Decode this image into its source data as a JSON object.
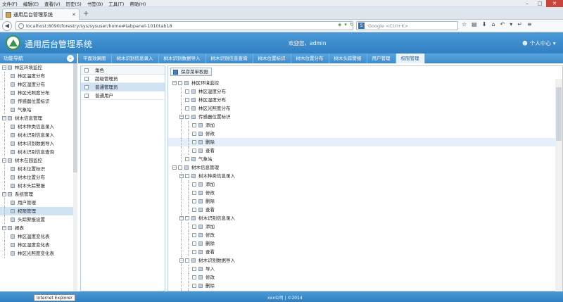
{
  "browser": {
    "menu": [
      "文件(F)",
      "编辑(E)",
      "查看(V)",
      "历史(S)",
      "书签(B)",
      "工具(T)",
      "帮助(H)"
    ],
    "tab_title": "通用后台管理系统",
    "url": "localhost:8090/forestry/sys/sysuser/home#tabpanel-1010tab18",
    "search_placeholder": "Google <Ctrl+K>"
  },
  "header": {
    "title": "通用后台管理系统",
    "welcome": "欢迎您，admin",
    "user_center": "个人中心"
  },
  "sidebar": {
    "title": "功能导航",
    "tree": [
      {
        "label": "林区环境监控",
        "level": 0,
        "type": "folder"
      },
      {
        "label": "林区温度分布",
        "level": 1,
        "type": "leaf"
      },
      {
        "label": "林区湿度分布",
        "level": 1,
        "type": "leaf"
      },
      {
        "label": "林区光照度分布",
        "level": 1,
        "type": "leaf"
      },
      {
        "label": "传感器位置标识",
        "level": 1,
        "type": "leaf"
      },
      {
        "label": "气象站",
        "level": 1,
        "type": "leaf"
      },
      {
        "label": "树木信息管理",
        "level": 0,
        "type": "folder"
      },
      {
        "label": "树木种类信息录入",
        "level": 1,
        "type": "leaf"
      },
      {
        "label": "树木识别信息录入",
        "level": 1,
        "type": "leaf"
      },
      {
        "label": "树木识别数据导入",
        "level": 1,
        "type": "leaf"
      },
      {
        "label": "树木识别信息查询",
        "level": 1,
        "type": "leaf"
      },
      {
        "label": "树木在园监控",
        "level": 0,
        "type": "folder"
      },
      {
        "label": "树木位置标识",
        "level": 1,
        "type": "leaf"
      },
      {
        "label": "树木位置分布",
        "level": 1,
        "type": "leaf"
      },
      {
        "label": "树木头踪警报",
        "level": 1,
        "type": "leaf"
      },
      {
        "label": "系统管理",
        "level": 0,
        "type": "folder"
      },
      {
        "label": "用户管理",
        "level": 1,
        "type": "leaf"
      },
      {
        "label": "权限管理",
        "level": 1,
        "type": "leaf",
        "selected": true
      },
      {
        "label": "头踪警报设置",
        "level": 1,
        "type": "leaf"
      },
      {
        "label": "报表",
        "level": 0,
        "type": "folder"
      },
      {
        "label": "林区温度变化表",
        "level": 1,
        "type": "leaf"
      },
      {
        "label": "林区湿度变化表",
        "level": 1,
        "type": "leaf"
      },
      {
        "label": "林区光照度变化表",
        "level": 1,
        "type": "leaf"
      }
    ]
  },
  "tabs": [
    "平面效果图",
    "树木识别信息录入",
    "树木识别数据导入",
    "树木识别信息查询",
    "树木位置标识",
    "树木位置分布",
    "树木头踪警报",
    "用户管理",
    "权限管理"
  ],
  "active_tab": 8,
  "roles": {
    "header": "角色",
    "rows": [
      {
        "label": "超级管理员",
        "selected": false
      },
      {
        "label": "普通管理员",
        "selected": true
      },
      {
        "label": "普通用户",
        "selected": false
      }
    ]
  },
  "permissions": {
    "save_label": "保存菜单权限",
    "tree": [
      {
        "label": "林区环境监控",
        "level": 0,
        "type": "folder"
      },
      {
        "label": "林区温度分布",
        "level": 1,
        "type": "leaf"
      },
      {
        "label": "林区湿度分布",
        "level": 1,
        "type": "leaf"
      },
      {
        "label": "林区光照度分布",
        "level": 1,
        "type": "leaf"
      },
      {
        "label": "传感器位置标识",
        "level": 1,
        "type": "folder"
      },
      {
        "label": "添加",
        "level": 2,
        "type": "leaf"
      },
      {
        "label": "修改",
        "level": 2,
        "type": "leaf"
      },
      {
        "label": "删除",
        "level": 2,
        "type": "leaf",
        "highlight": true
      },
      {
        "label": "查看",
        "level": 2,
        "type": "leaf"
      },
      {
        "label": "气象站",
        "level": 1,
        "type": "leaf"
      },
      {
        "label": "树木信息管理",
        "level": 0,
        "type": "folder"
      },
      {
        "label": "树木种类信息录入",
        "level": 1,
        "type": "folder"
      },
      {
        "label": "添加",
        "level": 2,
        "type": "leaf"
      },
      {
        "label": "修改",
        "level": 2,
        "type": "leaf"
      },
      {
        "label": "删除",
        "level": 2,
        "type": "leaf"
      },
      {
        "label": "查看",
        "level": 2,
        "type": "leaf"
      },
      {
        "label": "树木识别信息录入",
        "level": 1,
        "type": "folder"
      },
      {
        "label": "添加",
        "level": 2,
        "type": "leaf"
      },
      {
        "label": "修改",
        "level": 2,
        "type": "leaf"
      },
      {
        "label": "删除",
        "level": 2,
        "type": "leaf"
      },
      {
        "label": "查看",
        "level": 2,
        "type": "leaf"
      },
      {
        "label": "树木识别数据导入",
        "level": 1,
        "type": "folder"
      },
      {
        "label": "导入",
        "level": 2,
        "type": "leaf"
      },
      {
        "label": "修改",
        "level": 2,
        "type": "leaf"
      },
      {
        "label": "删除",
        "level": 2,
        "type": "leaf"
      },
      {
        "label": "查看",
        "level": 2,
        "type": "leaf"
      }
    ]
  },
  "status": {
    "tooltip": "Internet Explorer",
    "copyright": "xxx公司 | ©2014"
  },
  "colors": {
    "header_blue": "#3d8fd0",
    "selection": "#cfe3f5",
    "logo_green": "#2f9a46"
  }
}
